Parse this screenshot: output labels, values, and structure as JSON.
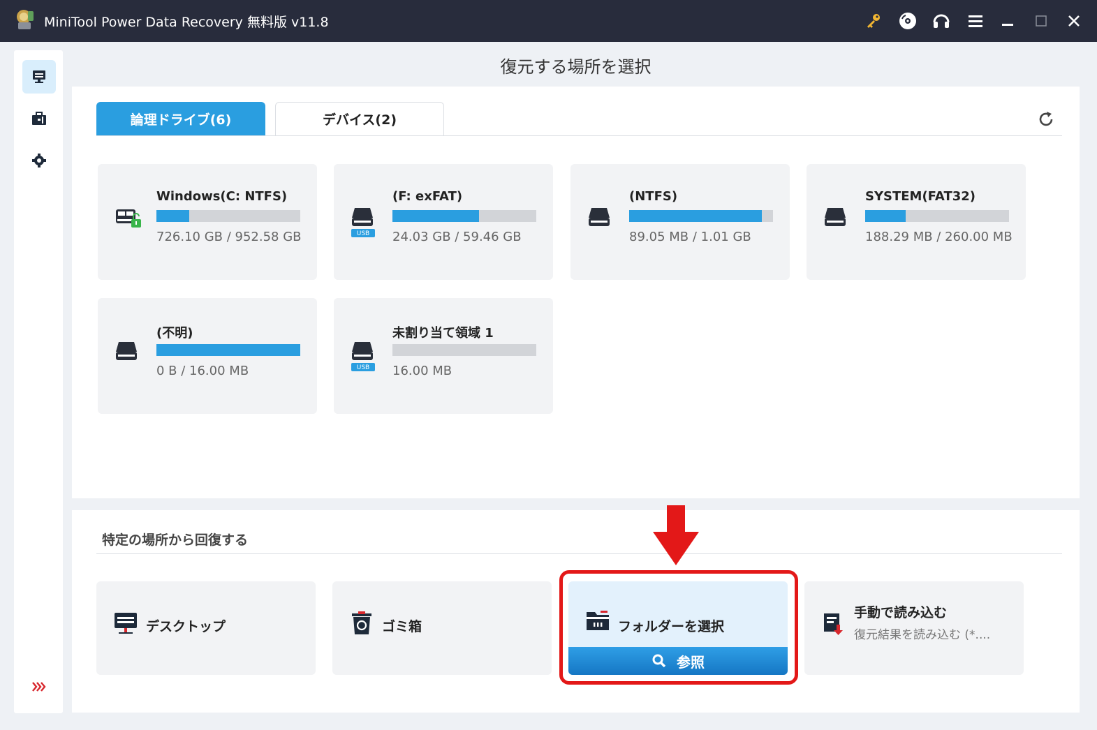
{
  "window": {
    "title": "MiniTool Power Data Recovery 無料版 v11.8",
    "buttons": [
      "key-icon",
      "disc-icon",
      "headset-icon",
      "menu-icon",
      "minimize-icon",
      "maximize-icon",
      "close-icon"
    ]
  },
  "sidebar": {
    "items": [
      {
        "icon": "computer-icon",
        "active": true
      },
      {
        "icon": "toolbox-icon",
        "active": false
      },
      {
        "icon": "gear-icon",
        "active": false
      }
    ],
    "expand_icon": "double-chevron-right-icon"
  },
  "main": {
    "title": "復元する場所を選択",
    "tabs": [
      {
        "label": "論理ドライブ(6)",
        "active": true
      },
      {
        "label": "デバイス(2)",
        "active": false
      }
    ],
    "drives": [
      {
        "name": "Windows(C: NTFS)",
        "size": "726.10 GB / 952.58 GB",
        "used_fraction": 0.23,
        "usb": false,
        "system": true
      },
      {
        "name": "(F: exFAT)",
        "size": "24.03 GB / 59.46 GB",
        "used_fraction": 0.6,
        "usb": true,
        "system": false
      },
      {
        "name": "(NTFS)",
        "size": "89.05 MB / 1.01 GB",
        "used_fraction": 0.92,
        "usb": false,
        "system": false
      },
      {
        "name": "SYSTEM(FAT32)",
        "size": "188.29 MB / 260.00 MB",
        "used_fraction": 0.28,
        "usb": false,
        "system": false
      },
      {
        "name": "(不明)",
        "size": "0 B / 16.00 MB",
        "used_fraction": 1.0,
        "usb": false,
        "system": false
      },
      {
        "name": "未割り当て領域 1",
        "size": "16.00 MB",
        "used_fraction": 0.0,
        "usb": true,
        "system": false
      }
    ],
    "usb_badge": "USB"
  },
  "locations": {
    "title": "特定の場所から回復する",
    "desktop_label": "デスクトップ",
    "recycle_label": "ゴミ箱",
    "folder_label": "フォルダーを選択",
    "browse_label": "参照",
    "load_title": "手動で読み込む",
    "load_subtitle": "復元結果を読み込む (*...."
  },
  "colors": {
    "accent": "#2a9ee0",
    "titlebar": "#282c3c",
    "highlight": "#e31818"
  }
}
